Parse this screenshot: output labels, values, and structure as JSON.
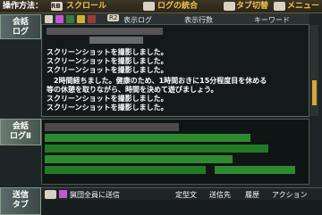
{
  "topbar": {
    "label": "操作方法：",
    "rb_icon": "RB RB",
    "scroll": "スクロール",
    "log_merge": "ログの統合",
    "tab_switch": "タブ切替",
    "menu": "メニュー"
  },
  "left_tabs": {
    "chat_log": "会話\nログ",
    "chat_log2_a": "会話",
    "chat_log2_b": "ログⅡ",
    "send_tab": "送信\nタブ"
  },
  "toolbar": {
    "r2": "R2",
    "display_log": "表示ログ",
    "display_lines": "表示行数",
    "keyword": "キーワード"
  },
  "log_lines": [
    "スクリーンショットを撮影しました。",
    "スクリーンショットを撮影しました。",
    "スクリーンショットを撮影しました。",
    "　2時間経ちました。健康のため、1時間おきに15分程度目を休める",
    "等の休憩を取りながら、時間を決めて遊びましょう。",
    "スクリーンショットを撮影しました。",
    "スクリーンショットを撮影しました。"
  ],
  "bottombar": {
    "send_label": "猟団全員に送信",
    "col_fixed": "定型文",
    "col_target": "送信先",
    "col_history": "履歴",
    "col_action": "アクション"
  },
  "colors": {
    "accent": "#f2c24a",
    "log_green": "#2fa02f",
    "panel_bg": "#141a1b"
  }
}
